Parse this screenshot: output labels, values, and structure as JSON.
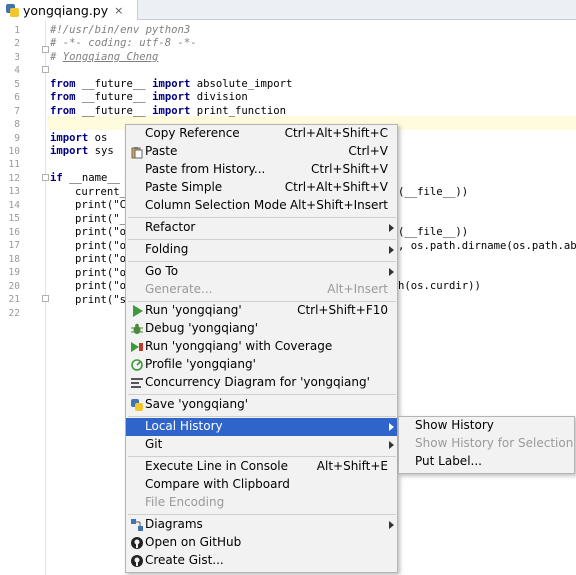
{
  "tab": {
    "filename": "yongqiang.py",
    "close": "×"
  },
  "gutter": {
    "line_numbers": [
      "1",
      "2",
      "3",
      "4",
      "5",
      "6",
      "7",
      "8",
      "9",
      "10",
      "11",
      "12",
      "13",
      "14",
      "15",
      "16",
      "17",
      "18",
      "19",
      "20",
      "21",
      "22"
    ]
  },
  "code": {
    "l1": "#!/usr/bin/env python3",
    "l2": "# -*- coding: utf-8 -*-",
    "l3_hash": "# ",
    "l3_name": "Yongqiang Cheng",
    "from": "from",
    "import": "import",
    "future": " __future__ ",
    "l5_mod": " absolute_import",
    "l6_mod": " division",
    "l7_mod": " print_function",
    "l9_mod": " os",
    "l10_mod": " sys",
    "if": "if",
    "l12_rest": " __name__",
    "l13": "current_",
    "l14": "print(\"C",
    "l15": "print(\"_",
    "l16": "print(\"o",
    "l17": "print(\"o",
    "l18": "print(\"o",
    "l19": "print(\"o",
    "l20": "print(\"o",
    "l21": "print(\"s",
    "r13": "(__file__))",
    "r16": "(__file__))",
    "r17": ", os.path.dirname(os.path.ab",
    "r20": "h(os.curdir))"
  },
  "menu": {
    "copy_reference": {
      "label": "Copy Reference",
      "shortcut": "Ctrl+Alt+Shift+C"
    },
    "paste": {
      "label": "Paste",
      "shortcut": "Ctrl+V"
    },
    "paste_history": {
      "label": "Paste from History...",
      "shortcut": "Ctrl+Shift+V"
    },
    "paste_simple": {
      "label": "Paste Simple",
      "shortcut": "Ctrl+Alt+Shift+V"
    },
    "column_selection": {
      "label": "Column Selection Mode",
      "shortcut": "Alt+Shift+Insert"
    },
    "refactor": {
      "label": "Refactor"
    },
    "folding": {
      "label": "Folding"
    },
    "goto": {
      "label": "Go To"
    },
    "generate": {
      "label": "Generate...",
      "shortcut": "Alt+Insert"
    },
    "run": {
      "label": "Run 'yongqiang'",
      "shortcut": "Ctrl+Shift+F10"
    },
    "debug": {
      "label": "Debug 'yongqiang'"
    },
    "run_coverage": {
      "label": "Run 'yongqiang' with Coverage"
    },
    "profile": {
      "label": "Profile 'yongqiang'"
    },
    "concurrency": {
      "label": "Concurrency Diagram for  'yongqiang'"
    },
    "save": {
      "label": "Save 'yongqiang'"
    },
    "local_history": {
      "label": "Local History"
    },
    "git": {
      "label": "Git"
    },
    "execute_line": {
      "label": "Execute Line in Console",
      "shortcut": "Alt+Shift+E"
    },
    "compare_clipboard": {
      "label": "Compare with Clipboard"
    },
    "file_encoding": {
      "label": "File Encoding"
    },
    "diagrams": {
      "label": "Diagrams"
    },
    "open_github": {
      "label": "Open on GitHub"
    },
    "create_gist": {
      "label": "Create Gist..."
    }
  },
  "submenu": {
    "show_history": "Show History",
    "show_history_selection": "Show History for Selection",
    "put_label": "Put Label..."
  },
  "colors": {
    "selection": "#2f65ca",
    "keyword": "#000080",
    "comment": "#808080",
    "string": "#008000"
  }
}
